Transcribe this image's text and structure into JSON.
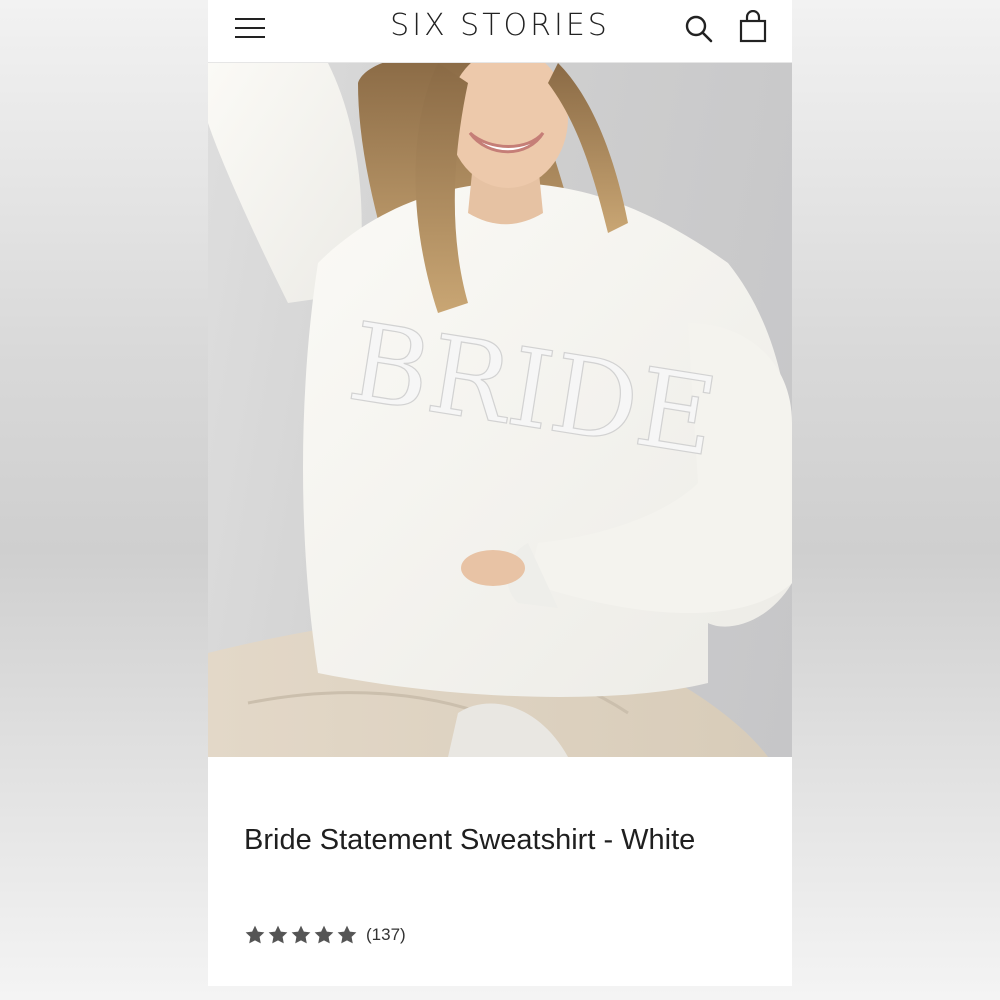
{
  "header": {
    "brand": "SIX STORIES",
    "menu_icon": "hamburger-menu-icon",
    "search_icon": "search-icon",
    "cart_icon": "shopping-bag-icon"
  },
  "hero": {
    "image_subject": "model wearing white sweatshirt",
    "sweatshirt_print": "BRIDE"
  },
  "product": {
    "title": "Bride Statement Sweatshirt - White",
    "rating": 5,
    "rating_max": 5,
    "review_count": "(137)"
  },
  "colors": {
    "star": "#555555",
    "text": "#1f1f1f",
    "background": "#ffffff"
  }
}
